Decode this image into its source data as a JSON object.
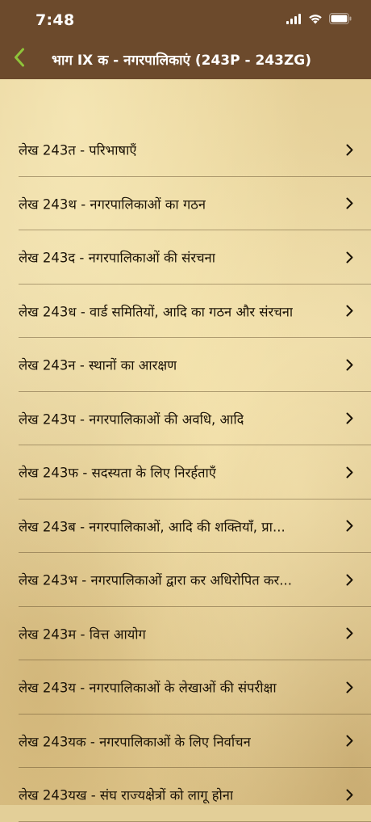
{
  "status": {
    "time": "7:48"
  },
  "nav": {
    "title": "भाग IX क - नगरपालिकाएं (243P - 243ZG)"
  },
  "articles": [
    {
      "label": "लेख 243त -  परिभाषाएँ"
    },
    {
      "label": "लेख 243थ -  नगरपालिकाओं का गठन"
    },
    {
      "label": "लेख 243द -  नगरपालिकाओं की संरचना"
    },
    {
      "label": "लेख 243ध -  वार्ड समितियों, आदि का गठन और संरचना"
    },
    {
      "label": "लेख 243न -  स्थानों का आरक्षण"
    },
    {
      "label": "लेख 243प -  नगरपालिकाओं की अवधि, आदि"
    },
    {
      "label": "लेख 243फ -  सदस्यता के लिए निरर्हताएँ"
    },
    {
      "label": "लेख 243ब -  नगरपालिकाओं, आदि की शक्तियाँ, प्रा..."
    },
    {
      "label": "लेख 243भ -  नगरपालिकाओं द्वारा कर अधिरोपित कर..."
    },
    {
      "label": "लेख 243म -  वित्त आयोग"
    },
    {
      "label": "लेख 243य -  नगरपालिकाओं के लेखाओं की संपरीक्षा"
    },
    {
      "label": "लेख 243यक -  नगरपालिकाओं के लिए निर्वाचन"
    },
    {
      "label": "लेख 243यख -  संघ राज्यक्षेत्रों को लागू होना"
    }
  ],
  "colors": {
    "header": "#6c4a2c",
    "back_arrow": "#8fc43a",
    "text": "#1a1206",
    "background": "#e3cf98"
  }
}
